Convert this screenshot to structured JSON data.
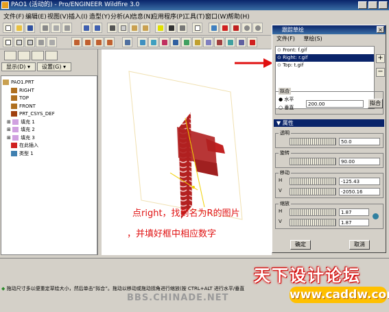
{
  "window": {
    "title": "PAO1 (活动的) - Pro/ENGINEER Wildfire 3.0"
  },
  "menubar": [
    "文件(F)",
    "编辑(E)",
    "视图(V)",
    "插入(I)",
    "造型(Y)",
    "分析(A)",
    "信息(N)",
    "应用程序(P)",
    "工具(T)",
    "窗口(W)",
    "帮助(H)"
  ],
  "left_panel": {
    "show_label": "显示(D) ▾",
    "settings_label": "设置(G) ▾",
    "tree": [
      {
        "label": "PAO1.PRT",
        "icon": "part-icon"
      },
      {
        "label": "RIGHT",
        "icon": "datum-plane-icon"
      },
      {
        "label": "TOP",
        "icon": "datum-plane-icon"
      },
      {
        "label": "FRONT",
        "icon": "datum-plane-icon"
      },
      {
        "label": "PRT_CSYS_DEF",
        "icon": "csys-icon"
      },
      {
        "label": "填充 1",
        "icon": "fill-icon"
      },
      {
        "label": "填充 2",
        "icon": "fill-icon"
      },
      {
        "label": "填充 3",
        "icon": "fill-icon"
      },
      {
        "label": "在此插入",
        "icon": "insert-here-icon"
      },
      {
        "label": "类型 1",
        "icon": "style-icon"
      }
    ]
  },
  "annotation": {
    "line1": "点right，找到名为R的图片",
    "line2": "，并填好框中相应数字"
  },
  "status": {
    "message": "拖动尺寸多以便重定草绘大小，然后单击“拟合”。拖动以移动或拖动拐角进行缩放(按 CTRL+ALT 进行水平/垂直"
  },
  "watermark": {
    "forum": "天下设计论坛",
    "url": "www.caddw.com",
    "bbs": "BBS.CHINADE.NET"
  },
  "dialog": {
    "title": "跟踪草绘",
    "menu": [
      "文件(F)",
      "草绘(S)"
    ],
    "images": [
      "Front: f.gif",
      "Right: r.gif",
      "Top: t.gif"
    ],
    "selected_index": 1,
    "add_label": "+",
    "remove_label": "−",
    "fit": {
      "label": "拟合",
      "horizontal": "水平",
      "vertical": "垂直",
      "value": "200.00",
      "button": "拟合",
      "selected": "horizontal"
    },
    "properties_label": "属性",
    "transparency": {
      "label": "透明",
      "value": "50.0"
    },
    "rotation": {
      "label": "旋转",
      "value": "90.00"
    },
    "move": {
      "label": "移动",
      "h_label": "H",
      "h_value": "-125.43",
      "v_label": "V",
      "v_value": "-2050.16"
    },
    "scale": {
      "label": "缩放",
      "h_label": "H",
      "h_value": "1.87",
      "v_label": "V",
      "v_value": "1.87"
    },
    "ok": "确定",
    "cancel": "取消"
  },
  "colors": {
    "accent": "#0a246a",
    "annotation": "#e01010",
    "model_red": "#b32020"
  }
}
